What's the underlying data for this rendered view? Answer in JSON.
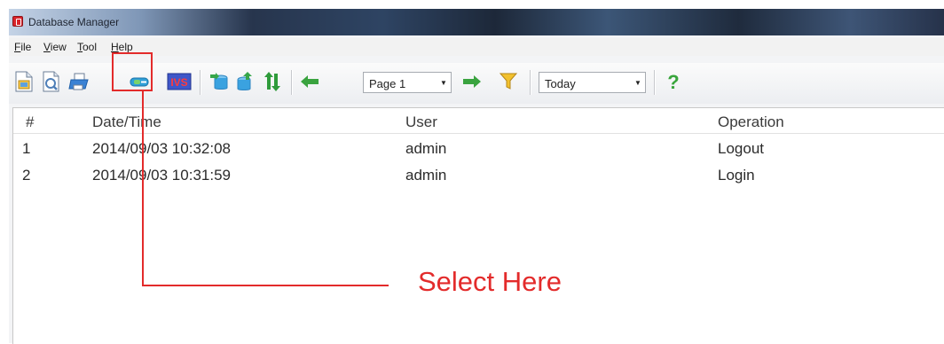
{
  "window": {
    "title": "Database Manager"
  },
  "menu": [
    "File",
    "View",
    "Tool",
    "Help"
  ],
  "toolbar": {
    "page_select": "Page 1",
    "date_select": "Today",
    "ivs_label": "IVS",
    "help_glyph": "?",
    "icons": [
      "new-doc-icon",
      "open-doc-icon",
      "print-icon",
      "export-icon",
      "ivs-icon",
      "db-import-icon",
      "db-export-icon",
      "sync-icon",
      "prev-page-icon",
      "next-page-icon",
      "filter-icon",
      "help-icon"
    ]
  },
  "table": {
    "columns": [
      "#",
      "Date/Time",
      "User",
      "Operation"
    ],
    "rows": [
      [
        "1",
        "2014/09/03 10:32:08",
        "admin",
        "Logout"
      ],
      [
        "2",
        "2014/09/03 10:31:59",
        "admin",
        "Login"
      ]
    ]
  },
  "annotation": {
    "text": "Select Here",
    "color": "#e32b2b"
  }
}
